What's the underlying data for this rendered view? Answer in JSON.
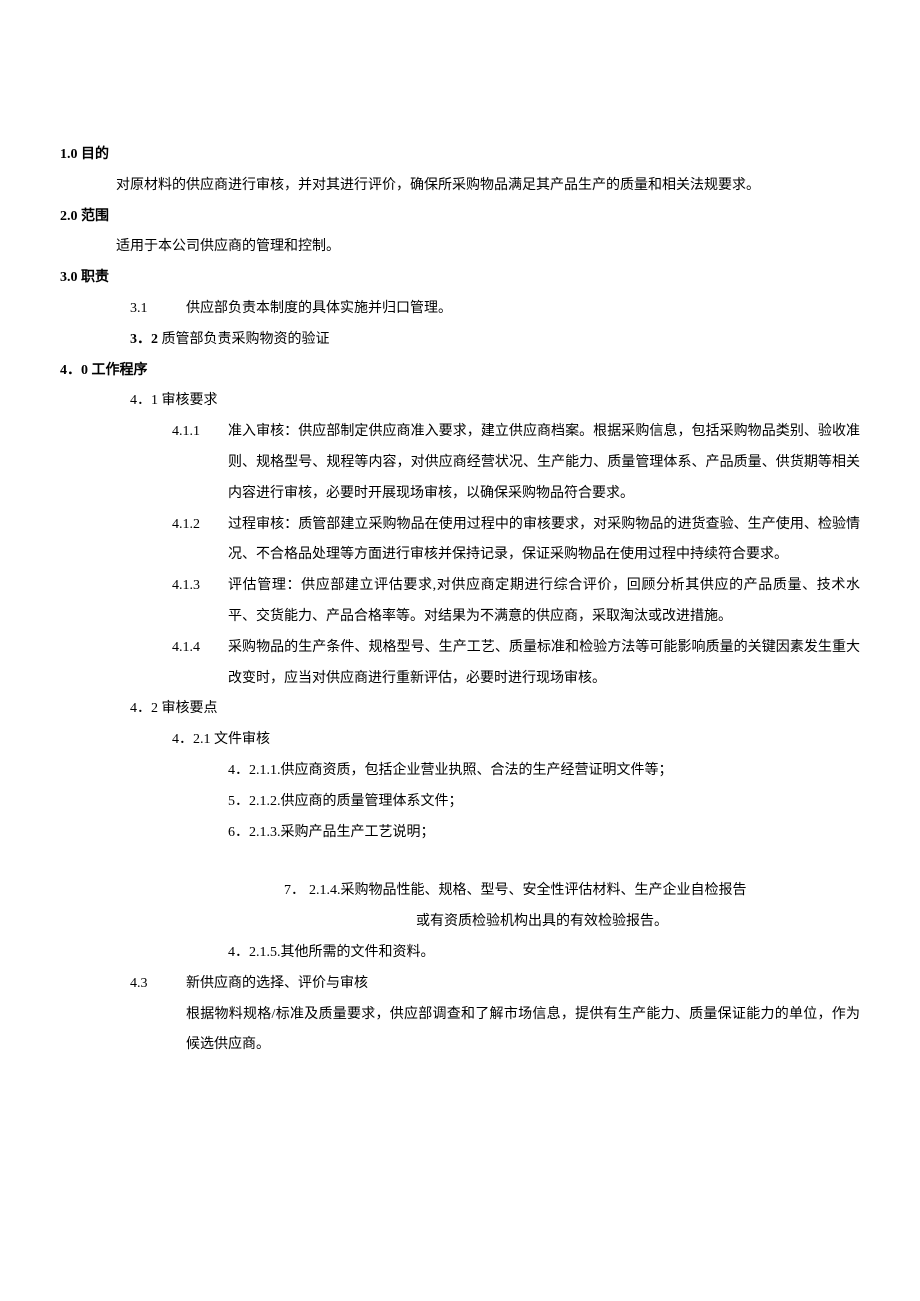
{
  "s1": {
    "heading": "1.0 目的",
    "body": "对原材料的供应商进行审核，并对其进行评价，确保所采购物品满足其产品生产的质量和相关法规要求。"
  },
  "s2": {
    "heading": "2.0 范围",
    "body": "适用于本公司供应商的管理和控制。"
  },
  "s3": {
    "heading": "3.0 职责",
    "i1": {
      "num": "3.1",
      "text": "供应部负责本制度的具体实施并归口管理。"
    },
    "i2": {
      "num": "3．2",
      "text": "质管部负责采购物资的验证"
    }
  },
  "s4": {
    "heading": "4．0 工作程序",
    "s41": {
      "heading": "4．1  审核要求",
      "i1": {
        "num": "4.1.1",
        "text": "准入审核：供应部制定供应商准入要求，建立供应商档案。根据采购信息，包括采购物品类别、验收准则、规格型号、规程等内容，对供应商经营状况、生产能力、质量管理体系、产品质量、供货期等相关内容进行审核，必要时开展现场审核，以确保采购物品符合要求。"
      },
      "i2": {
        "num": "4.1.2",
        "text": "过程审核：质管部建立采购物品在使用过程中的审核要求，对采购物品的进货查验、生产使用、检验情况、不合格品处理等方面进行审核并保持记录，保证采购物品在使用过程中持续符合要求。"
      },
      "i3": {
        "num": "4.1.3",
        "text": "评估管理：供应部建立评估要求,对供应商定期进行综合评价，回顾分析其供应的产品质量、技术水平、交货能力、产品合格率等。对结果为不满意的供应商，采取淘汰或改进措施。"
      },
      "i4": {
        "num": "4.1.4",
        "text": "采购物品的生产条件、规格型号、生产工艺、质量标准和检验方法等可能影响质量的关键因素发生重大改变时，应当对供应商进行重新评估，必要时进行现场审核。"
      }
    },
    "s42": {
      "heading": "4．2 审核要点",
      "s421": {
        "heading": "4．2.1 文件审核",
        "i1": "4．2.1.1.供应商资质，包括企业营业执照、合法的生产经营证明文件等；",
        "i2": "5．2.1.2.供应商的质量管理体系文件；",
        "i3": "6．2.1.3.采购产品生产工艺说明；",
        "i4num": "7．",
        "i4a": "2.1.4.采购物品性能、规格、型号、安全性评估材料、生产企业自检报告",
        "i4b": "或有资质检验机构出具的有效检验报告。",
        "i5": "4．2.1.5.其他所需的文件和资料。"
      }
    },
    "s43": {
      "num": "4.3",
      "title": "新供应商的选择、评价与审核",
      "body": "根据物料规格/标准及质量要求，供应部调查和了解市场信息，提供有生产能力、质量保证能力的单位，作为候选供应商。"
    }
  }
}
